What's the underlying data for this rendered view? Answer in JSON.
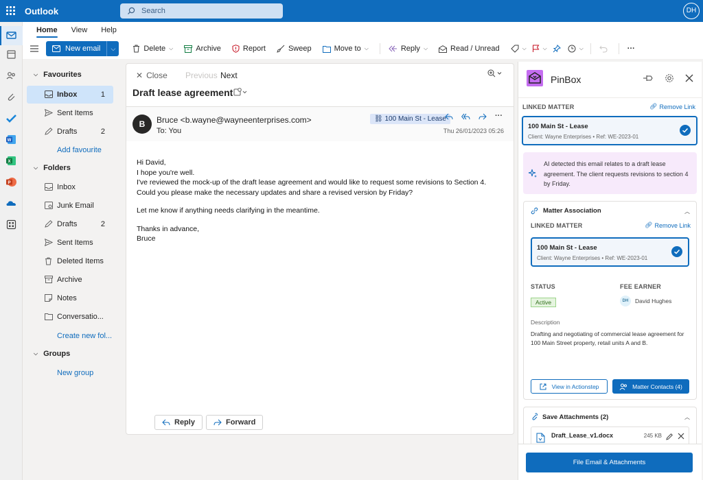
{
  "app": {
    "name": "Outlook",
    "search_placeholder": "Search",
    "user_initials": "DH"
  },
  "rail": {
    "icons": [
      "mail-icon",
      "calendar-icon",
      "people-icon",
      "attach-icon",
      "todo-icon",
      "word-icon",
      "excel-icon",
      "powerpoint-icon",
      "onedrive-icon",
      "apps-icon"
    ]
  },
  "ribbon": {
    "tabs": [
      "Home",
      "View",
      "Help"
    ],
    "new_email": "New email",
    "delete": "Delete",
    "archive": "Archive",
    "report": "Report",
    "sweep": "Sweep",
    "move_to": "Move to",
    "reply": "Reply",
    "read_unread": "Read / Unread",
    "more": "···"
  },
  "folders": {
    "favourites": "Favourites",
    "fav_items": [
      {
        "label": "Inbox",
        "count": "1"
      },
      {
        "label": "Sent Items",
        "count": ""
      },
      {
        "label": "Drafts",
        "count": "2"
      }
    ],
    "add_favourite": "Add favourite",
    "folders_title": "Folders",
    "items": [
      {
        "label": "Inbox",
        "count": ""
      },
      {
        "label": "Junk Email",
        "count": ""
      },
      {
        "label": "Drafts",
        "count": "2"
      },
      {
        "label": "Sent Items",
        "count": ""
      },
      {
        "label": "Deleted Items",
        "count": ""
      },
      {
        "label": "Archive",
        "count": ""
      },
      {
        "label": "Notes",
        "count": ""
      },
      {
        "label": "Conversatio...",
        "count": ""
      }
    ],
    "create_new": "Create new fol...",
    "groups": "Groups",
    "new_group": "New group"
  },
  "message": {
    "close": "Close",
    "previous": "Previous",
    "next": "Next",
    "subject": "Draft lease agreement",
    "avatar": "B",
    "from": "Bruce <b.wayne@wayneenterprises.com>",
    "to": "To:  You",
    "tag": "100 Main St - Lease",
    "date": "Thu 26/01/2023 05:26",
    "body": [
      "Hi David,",
      "I hope you're well.",
      "I've reviewed the mock-up of the draft lease agreement and would like to request some revisions to Section 4. Could you please make the necessary updates and share a revised version by Friday?",
      "",
      "Let me know if anything needs clarifying in the meantime.",
      "",
      "Thanks in advance,",
      "Bruce"
    ],
    "reply": "Reply",
    "forward": "Forward"
  },
  "pinbox": {
    "title": "PinBox",
    "linked_matter_label": "LINKED MATTER",
    "remove_link": "Remove Link",
    "matter_name": "100 Main St - Lease",
    "matter_client": "Client: Wayne Enterprises • Ref: WE-2023-01",
    "ai_text": "AI detected this email relates to a draft lease agreement. The client requests revisions to section 4 by Friday.",
    "assoc_title": "Matter Association",
    "status_label": "STATUS",
    "status_value": "Active",
    "fee_label": "FEE EARNER",
    "fee_initials": "DH",
    "fee_name": "David Hughes",
    "desc_label": "Description",
    "desc_text": "Drafting and negotiating of commercial lease agreement for 100 Main Street property, retail units A and B.",
    "view_btn": "View in Actionstep",
    "contacts_btn": "Matter Contacts (4)",
    "attach_title": "Save Attachments (2)",
    "attachment_name": "Draft_Lease_v1.docx",
    "attachment_size": "245 KB",
    "file_btn": "File Email & Attachments"
  }
}
